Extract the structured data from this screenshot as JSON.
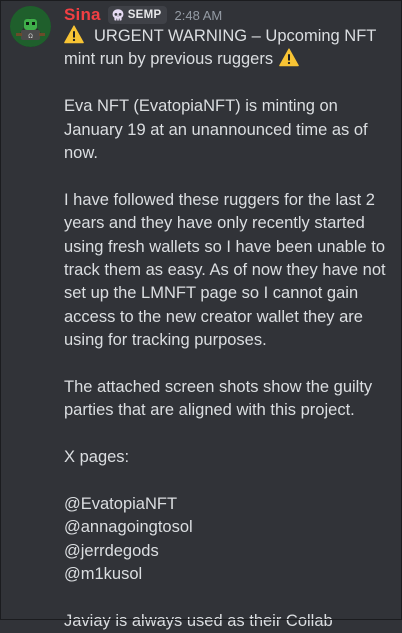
{
  "message": {
    "author": "Sina",
    "tag": "SEMP",
    "tag_icon": "skull-icon",
    "timestamp": "2:48 AM",
    "colors": {
      "username": "#f23f43",
      "background": "#313338",
      "text": "#dbdee1",
      "timestamp": "#949ba4",
      "tag_background": "#3f4147",
      "warning_yellow": "#f8c434"
    },
    "warning_icon": "warning-icon",
    "paragraphs": {
      "headline": "URGENT WARNING – Upcoming NFT mint run by previous ruggers",
      "p1": "Eva NFT (EvatopiaNFT) is minting on January 19 at an unannounced time as of now.",
      "p2": "I have followed these ruggers for the last 2 years and they have only recently started using fresh wallets so I have been unable to track them as easy. As of now they have not set up the LMNFT page so I cannot gain access to the new creator wallet they are using for tracking purposes.",
      "p3": "The attached screen shots show the guilty parties that are aligned with this project.",
      "x_pages_label": "X pages:",
      "handles": [
        "@EvatopiaNFT",
        "@annagoingtosol",
        "@jerrdegods",
        "@m1kusol"
      ],
      "p4": "Javiay is always used as their Collab"
    }
  }
}
